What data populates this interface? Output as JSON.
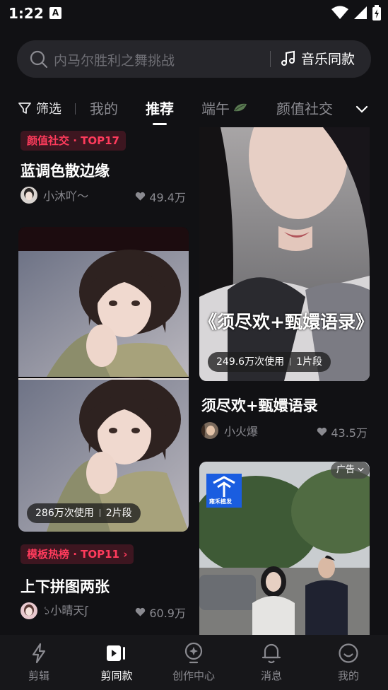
{
  "status_bar": {
    "time": "1:22",
    "a_icon": "A"
  },
  "search": {
    "placeholder": "内马尔胜利之舞挑战",
    "music_label": "音乐同款"
  },
  "tabs": {
    "filter_label": "筛选",
    "items": [
      {
        "label": "我的"
      },
      {
        "label": "推荐"
      },
      {
        "label": "端午"
      },
      {
        "label": "颜值社交"
      }
    ],
    "active_index": 1
  },
  "feed": {
    "left": [
      {
        "tag": "颜值社交 · TOP17",
        "title": "蓝调色散边缘",
        "author": "小沐吖～",
        "likes": "49.4万"
      },
      {
        "usage_count": "286万次使用",
        "segments": "2片段",
        "tag": "模板热榜 · TOP11 ›",
        "title": "上下拼图两张",
        "author": "১小晴天ʃ",
        "likes": "60.9万"
      }
    ],
    "right": [
      {
        "overlay_text": "《须尽欢+甄嬛语录》",
        "usage_count": "249.6万次使用",
        "segments": "1片段",
        "title": "须尽欢+甄嬛语录",
        "author": "小火爆",
        "likes": "43.5万"
      },
      {
        "ad_label": "广告",
        "brand_label": "雍禾植发"
      }
    ]
  },
  "bottom_nav": [
    {
      "label": "剪辑"
    },
    {
      "label": "剪同款"
    },
    {
      "label": "创作中心"
    },
    {
      "label": "消息"
    },
    {
      "label": "我的"
    }
  ],
  "colors": {
    "background": "#111114",
    "tag_text": "#ff3b5c",
    "tag_bg": "#3d1620",
    "muted_text": "#8a8a90"
  }
}
